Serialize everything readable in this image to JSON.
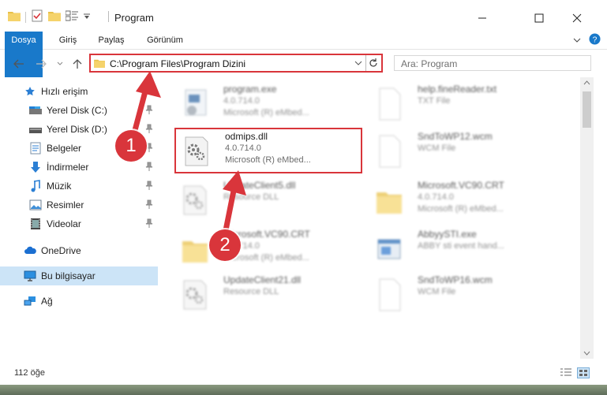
{
  "window": {
    "title": "Program",
    "ribbon_tabs": [
      "Dosya",
      "Giriş",
      "Paylaş",
      "Görünüm"
    ]
  },
  "address_bar": {
    "path": "C:\\Program Files\\Program Dizini"
  },
  "search": {
    "placeholder": "Ara: Program"
  },
  "sidebar": {
    "items": [
      {
        "label": "Hızlı erişim",
        "icon": "star-icon"
      },
      {
        "label": "Yerel Disk (C:)",
        "icon": "drive-icon"
      },
      {
        "label": "Yerel Disk (D:)",
        "icon": "drive-icon"
      },
      {
        "label": "Belgeler",
        "icon": "document-icon"
      },
      {
        "label": "İndirmeler",
        "icon": "download-icon"
      },
      {
        "label": "Müzik",
        "icon": "music-icon"
      },
      {
        "label": "Resimler",
        "icon": "pictures-icon"
      },
      {
        "label": "Videolar",
        "icon": "video-icon"
      },
      {
        "label": "OneDrive",
        "icon": "cloud-icon"
      },
      {
        "label": "Bu bilgisayar",
        "icon": "computer-icon"
      },
      {
        "label": "Ağ",
        "icon": "network-icon"
      }
    ]
  },
  "files": [
    {
      "name": "program.exe",
      "line2": "4.0.714.0",
      "line3": "Microsoft (R) eMbed...",
      "icon": "exe-icon"
    },
    {
      "name": "help.fineReader.txt",
      "line2": "TXT File",
      "line3": "",
      "icon": "text-file-icon"
    },
    {
      "name": "odmips.dll",
      "line2": "4.0.714.0",
      "line3": "Microsoft (R) eMbed...",
      "icon": "dll-gear-icon"
    },
    {
      "name": "SndToWP12.wcm",
      "line2": "WCM File",
      "line3": "",
      "icon": "blank-file-icon"
    },
    {
      "name": "UpdateClient5.dll",
      "line2": "Resource DLL",
      "line3": "",
      "icon": "dll-gear-icon"
    },
    {
      "name": "Microsoft.VC90.CRT",
      "line2": "4.0.714.0",
      "line3": "Microsoft (R) eMbed...",
      "icon": "folder-icon"
    },
    {
      "name": "Microsoft.VC90.CRT",
      "line2": "4.0.714.0",
      "line3": "Microsoft (R) eMbed...",
      "icon": "folder-icon"
    },
    {
      "name": "AbbyySTI.exe",
      "line2": "ABBY sti event hand...",
      "line3": "",
      "icon": "exe-window-icon"
    },
    {
      "name": "UpdateClient21.dll",
      "line2": "Resource DLL",
      "line3": "",
      "icon": "dll-gear-icon"
    },
    {
      "name": "SndToWP16.wcm",
      "line2": "WCM File",
      "line3": "",
      "icon": "blank-file-icon"
    }
  ],
  "status": {
    "item_count": "112 öğe"
  },
  "callouts": [
    "1",
    "2"
  ],
  "colors": {
    "accent": "#1979ca",
    "highlight": "#d9353b",
    "selected": "#cce4f7"
  }
}
